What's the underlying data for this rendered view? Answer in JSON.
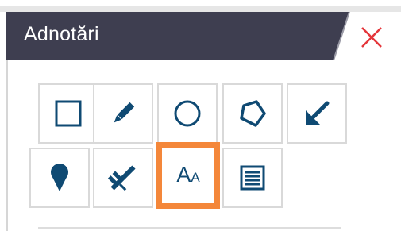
{
  "panel": {
    "title": "Adnotări",
    "colors": {
      "header_bg": "#3e3e50",
      "icon": "#0f4a73",
      "close": "#e4353a",
      "selected_border": "#f4873a"
    }
  },
  "tools": [
    {
      "name": "rectangle",
      "icon": "rectangle-icon"
    },
    {
      "name": "pencil",
      "icon": "pencil-icon"
    },
    {
      "name": "circle",
      "icon": "circle-icon"
    },
    {
      "name": "polygon",
      "icon": "polygon-icon"
    },
    {
      "name": "arrow",
      "icon": "arrow-icon"
    },
    {
      "name": "pin",
      "icon": "map-pin-icon"
    },
    {
      "name": "measure",
      "icon": "caliper-icon"
    },
    {
      "name": "text",
      "icon": "text-icon",
      "selected": true,
      "glyph_big": "A",
      "glyph_small": "A"
    },
    {
      "name": "note",
      "icon": "notes-icon"
    }
  ]
}
